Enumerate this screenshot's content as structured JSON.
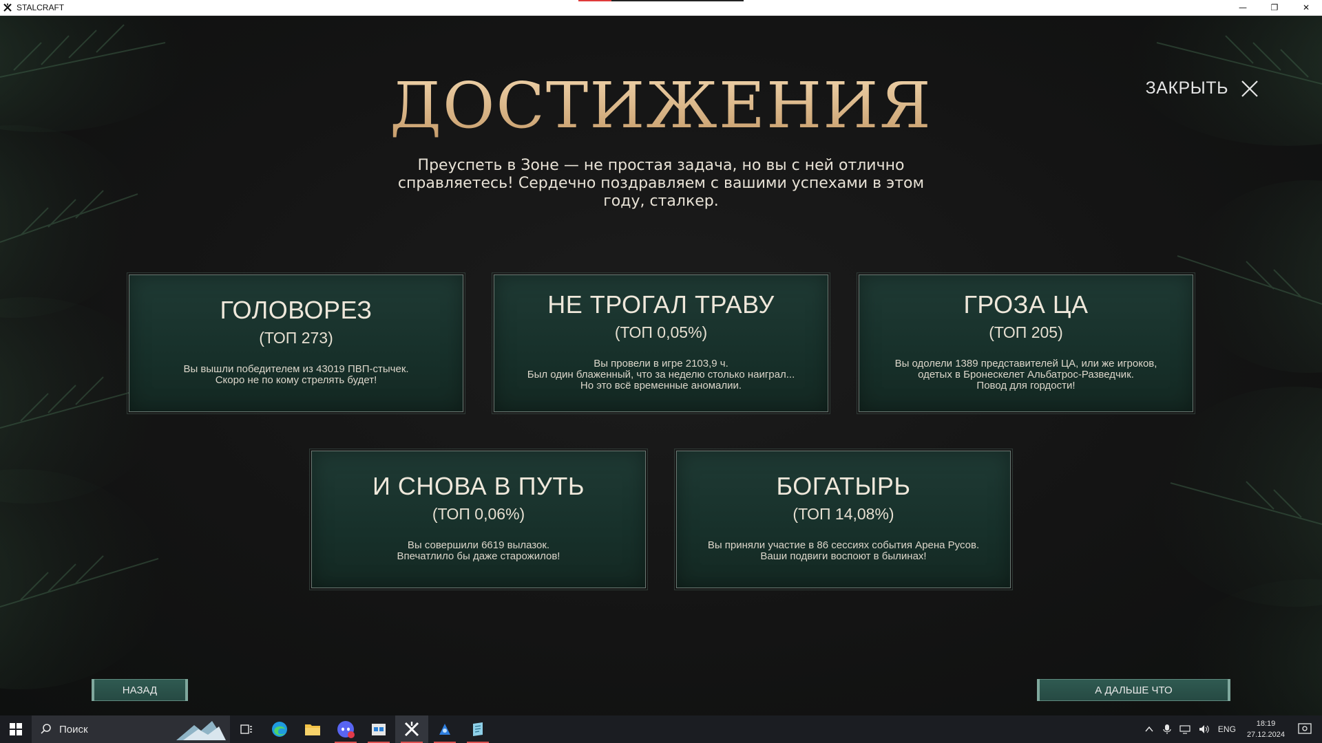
{
  "window": {
    "title": "STALCRAFT",
    "controls": {
      "minimize": "—",
      "restore": "❐",
      "close": "✕"
    }
  },
  "page": {
    "title": "ДОСТИЖЕНИЯ",
    "close_label": "ЗАКРЫТЬ",
    "subtitle": "Преуспеть в Зоне — не простая задача, но вы с ней отлично справляетесь! Сердечно поздравляем с вашими успехами в этом году, сталкер."
  },
  "cards": [
    {
      "title": "ГОЛОВОРЕЗ",
      "rank": "(ТОП 273)",
      "desc_lines": [
        "Вы вышли победителем из 43019 ПВП-стычек.",
        "Скоро не по кому стрелять будет!"
      ]
    },
    {
      "title": "НЕ ТРОГАЛ ТРАВУ",
      "rank": "(ТОП 0,05%)",
      "desc_lines": [
        "Вы провели в игре 2103,9 ч.",
        "Был один блаженный, что за неделю столько наиграл...",
        "Но это всё временные аномалии."
      ]
    },
    {
      "title": "ГРОЗА ЦА",
      "rank": "(ТОП 205)",
      "desc_lines": [
        "Вы одолели 1389 представителей ЦА, или же игроков,",
        "одетых в Бронескелет Альбатрос-Разведчик.",
        "Повод для гордости!"
      ]
    },
    {
      "title": "И СНОВА В ПУТЬ",
      "rank": "(ТОП 0,06%)",
      "desc_lines": [
        "Вы совершили 6619 вылазок.",
        "Впечатлило бы даже старожилов!"
      ]
    },
    {
      "title": "БОГАТЫРЬ",
      "rank": "(ТОП 14,08%)",
      "desc_lines": [
        "Вы приняли участие в 86 сессиях события Арена Русов.",
        "Ваши подвиги воспоют в былинах!"
      ]
    }
  ],
  "nav": {
    "back_label": "НАЗАД",
    "next_label": "А ДАЛЬШЕ ЧТО"
  },
  "taskbar": {
    "search_placeholder": "Поиск",
    "apps": [
      "task-view-icon",
      "edge-icon",
      "file-explorer-icon",
      "discord-icon",
      "store-icon",
      "stalcraft-icon",
      "game-launcher-icon",
      "notes-icon"
    ],
    "tray": {
      "language": "ENG",
      "time": "18:19",
      "date": "27.12.2024"
    }
  },
  "colors": {
    "title_gold": "#d6b58a",
    "card_green": "#1f3a34",
    "button_teal": "#2f5a51"
  }
}
